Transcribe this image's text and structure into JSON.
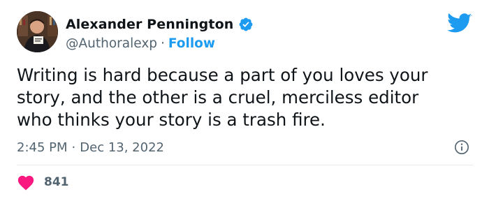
{
  "author": {
    "name": "Alexander Pennington",
    "handle": "@Authoralexp",
    "separator": "·",
    "follow_label": "Follow"
  },
  "tweet": {
    "lines": [
      "Writing is hard because a part of you loves your",
      "story, and the other is a cruel, merciless editor",
      "who thinks your story is a trash fire."
    ]
  },
  "meta": {
    "time": "2:45 PM",
    "separator": "·",
    "date": "Dec 13, 2022"
  },
  "engagement": {
    "likes": "841"
  },
  "icons": {
    "verified": "verified-badge-icon",
    "bird": "twitter-bird-icon",
    "info": "info-icon",
    "heart": "heart-icon"
  },
  "colors": {
    "brand_blue": "#1d9bf0",
    "heart_pink": "#f91880",
    "text": "#0f1419",
    "secondary": "#536471"
  }
}
